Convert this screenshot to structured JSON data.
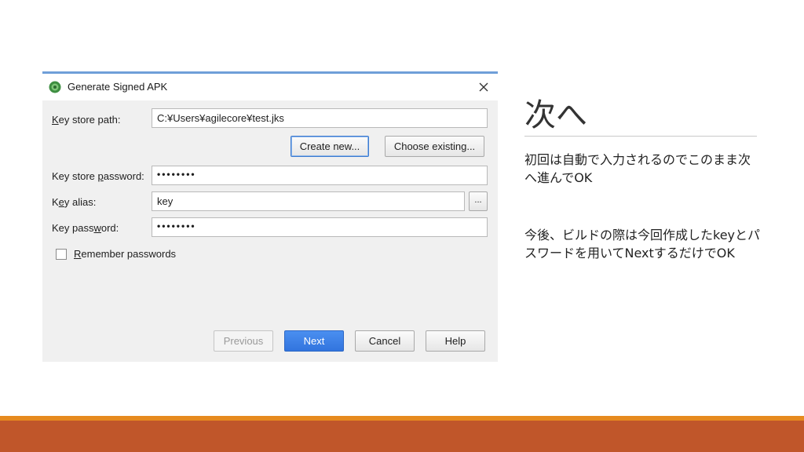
{
  "dialog": {
    "title": "Generate Signed APK",
    "fields": {
      "key_store_path": {
        "label_key": "K",
        "label_rest": "ey store path:",
        "value": "C:¥Users¥agilecore¥test.jks"
      },
      "key_store_password": {
        "label_pre": "Key store ",
        "label_key": "p",
        "label_rest": "assword:",
        "value": "••••••••"
      },
      "key_alias": {
        "label_pre": "K",
        "label_key": "e",
        "label_rest": "y alias:",
        "value": "key",
        "browse_label": "..."
      },
      "key_password": {
        "label_pre": "Key pass",
        "label_key": "w",
        "label_rest": "ord:",
        "value": "••••••••"
      }
    },
    "create_new_label": "Create new...",
    "choose_existing_label": "Choose existing...",
    "remember": {
      "label_key": "R",
      "label_rest": "emember passwords",
      "checked": false
    },
    "buttons": {
      "previous": "Previous",
      "next": "Next",
      "cancel": "Cancel",
      "help": "Help"
    }
  },
  "slide": {
    "heading": "次へ",
    "para1": "初回は自動で入力されるのでこのまま次へ進んでOK",
    "para2": "今後、ビルドの際は今回作成したkeyとパスワードを用いてNextするだけでOK"
  },
  "colors": {
    "footer_bar": "#c0562a",
    "footer_line": "#e68a1f",
    "primary_button": "#3274de"
  },
  "icons": {
    "app": "android-studio-icon",
    "close": "close-icon"
  }
}
